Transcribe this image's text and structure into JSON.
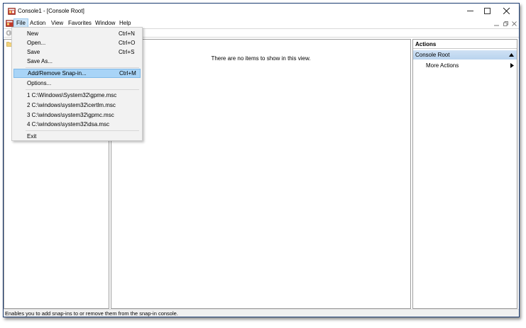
{
  "window": {
    "title": "Console1 - [Console Root]",
    "accent": "#1c3d73"
  },
  "menu": {
    "file": "File",
    "action": "Action",
    "view": "View",
    "favorites": "Favorites",
    "window": "Window",
    "help": "Help"
  },
  "file_menu": {
    "new": {
      "label": "New",
      "shortcut": "Ctrl+N"
    },
    "open": {
      "label": "Open...",
      "shortcut": "Ctrl+O"
    },
    "save": {
      "label": "Save",
      "shortcut": "Ctrl+S"
    },
    "save_as": {
      "label": "Save As..."
    },
    "add_remove": {
      "label": "Add/Remove Snap-in...",
      "shortcut": "Ctrl+M"
    },
    "options": {
      "label": "Options..."
    },
    "recent": [
      "1 C:\\Windows\\System32\\gpme.msc",
      "2 C:\\windows\\system32\\certlm.msc",
      "3 C:\\windows\\system32\\gpmc.msc",
      "4 C:\\windows\\system32\\dsa.msc"
    ],
    "exit": {
      "label": "Exit"
    },
    "highlight_color": "#a8d4f7"
  },
  "center": {
    "empty_message": "There are no items to show in this view."
  },
  "actions": {
    "title": "Actions",
    "section": "Console Root",
    "more": "More Actions"
  },
  "status": {
    "text": "Enables you to add snap-ins to or remove them from the snap-in console."
  }
}
